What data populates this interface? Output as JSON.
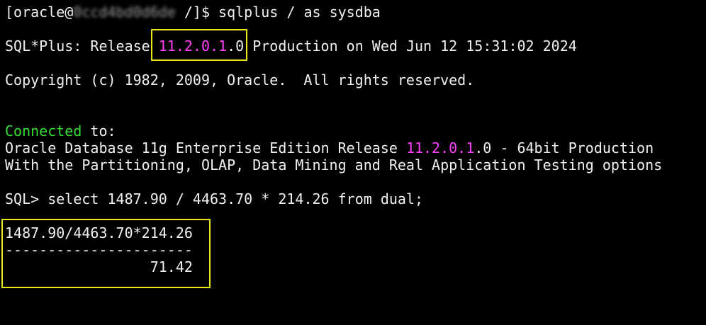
{
  "terminal": {
    "prompt_user": "[oracle@",
    "prompt_host": "0ccd4bd0d6de",
    "prompt_path": " /]$ ",
    "command": "sqlplus / as sysdba",
    "banner": {
      "prefix": "SQL*Plus: Release ",
      "version_highlight": "11.2.0.1",
      "version_tail": ".0",
      "suffix": " Production on Wed Jun 12 15:31:02 2024"
    },
    "copyright": "Copyright (c) 1982, 2009, Oracle.  All rights reserved.",
    "connected_word": "Connected",
    "connected_tail": " to:",
    "db_line_prefix": "Oracle Database 11g Enterprise Edition Release ",
    "db_version_highlight": "11.2.0.1",
    "db_line_suffix": ".0 - 64bit Production",
    "options_line": "With the Partitioning, OLAP, Data Mining and Real Application Testing options",
    "sql_prompt": "SQL> ",
    "sql_query": "select 1487.90 / 4463.70 * 214.26 from dual;",
    "result_header": "1487.90/4463.70*214.26",
    "result_separator": "----------------------",
    "result_value": "                 71.42"
  },
  "colors": {
    "background": "#000000",
    "text": "#f0f0f0",
    "version_highlight": "#ff40ff",
    "connected": "#33dd33",
    "annotation_box": "#e6e619"
  }
}
